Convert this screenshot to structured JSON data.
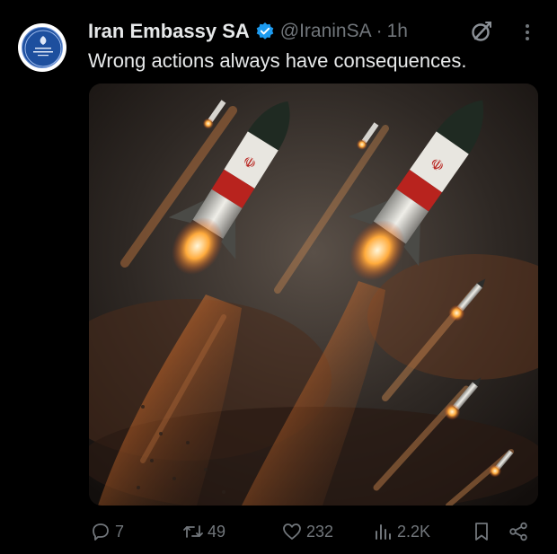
{
  "tweet": {
    "author_name": "Iran Embassy SA",
    "handle": "@IraninSA",
    "separator": "·",
    "time": "1h",
    "text": "Wrong actions always have consequences."
  },
  "icons": {
    "verified": "verified-badge-icon",
    "grok": "grok-icon",
    "more": "more-options-icon",
    "reply": "reply-icon",
    "retweet": "retweet-icon",
    "like": "like-icon",
    "views": "views-icon",
    "bookmark": "bookmark-icon",
    "share": "share-icon"
  },
  "actions": {
    "replies": "7",
    "retweets": "49",
    "likes": "232",
    "views": "2.2K"
  },
  "colors": {
    "background": "#000000",
    "primary_text": "#e7e9ea",
    "secondary_text": "#71767b",
    "verified_blue": "#1d9bf0"
  }
}
